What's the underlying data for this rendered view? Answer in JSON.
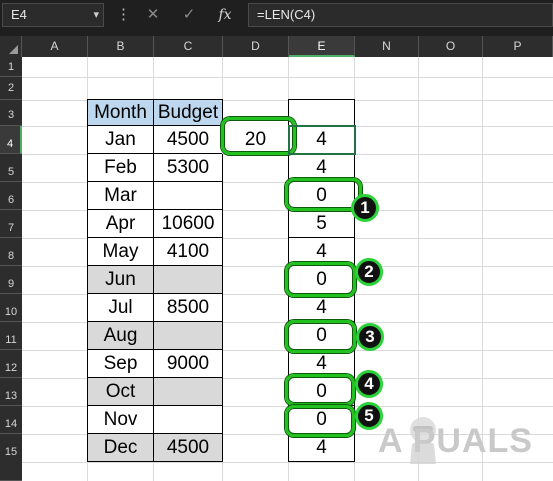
{
  "formula_bar": {
    "name_box": "E4",
    "formula": "=LEN(C4)",
    "cancel_symbol": "✕",
    "enter_symbol": "✓",
    "fx_label": "fx"
  },
  "columns": [
    "A",
    "B",
    "C",
    "D",
    "E",
    "N",
    "O",
    "P"
  ],
  "rows": [
    "1",
    "2",
    "3",
    "4",
    "5",
    "6",
    "7",
    "8",
    "9",
    "10",
    "11",
    "12",
    "13",
    "14",
    "15"
  ],
  "table": {
    "header_month": "Month",
    "header_budget": "Budget",
    "months": [
      "Jan",
      "Feb",
      "Mar",
      "Apr",
      "May",
      "Jun",
      "Jul",
      "Aug",
      "Sep",
      "Oct",
      "Nov",
      "Dec"
    ],
    "budgets": [
      "4500",
      "5300",
      "",
      "10600",
      "4100",
      "",
      "8500",
      "",
      "9000",
      "",
      "",
      "4500"
    ],
    "lengths": [
      "4",
      "4",
      "0",
      "5",
      "4",
      "0",
      "4",
      "0",
      "4",
      "0",
      "0",
      "4"
    ],
    "d4_value": "20"
  },
  "badges": [
    "1",
    "2",
    "3",
    "4",
    "5"
  ],
  "watermark": "A PUALS",
  "colors": {
    "header_fill": "#bdd7ee",
    "empty_fill": "#d9d9d9",
    "highlight": "#22c11f",
    "excel_green": "#217346"
  }
}
